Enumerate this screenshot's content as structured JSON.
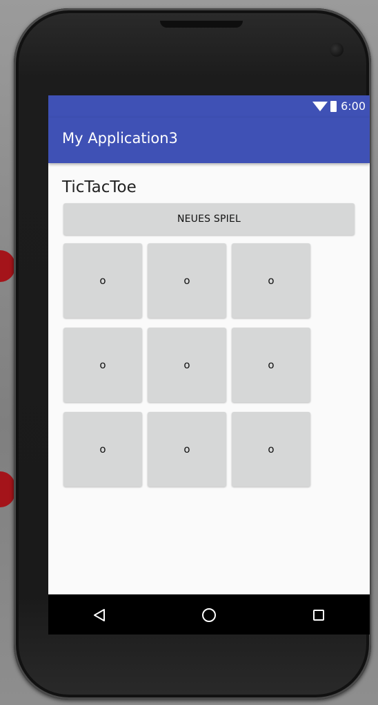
{
  "status_bar": {
    "time": "6:00"
  },
  "app_bar": {
    "title": "My Application3"
  },
  "main": {
    "title": "TicTacToe",
    "new_game_label": "NEUES SPIEL",
    "cells": [
      "o",
      "o",
      "o",
      "o",
      "o",
      "o",
      "o",
      "o",
      "o"
    ]
  },
  "nav": {
    "back_icon": "back-triangle-icon",
    "home_icon": "home-circle-icon",
    "recent_icon": "recent-apps-square-icon"
  },
  "colors": {
    "primary": "#3f51b5",
    "button_grey": "#d6d7d7",
    "screen_bg": "#fafafa"
  }
}
